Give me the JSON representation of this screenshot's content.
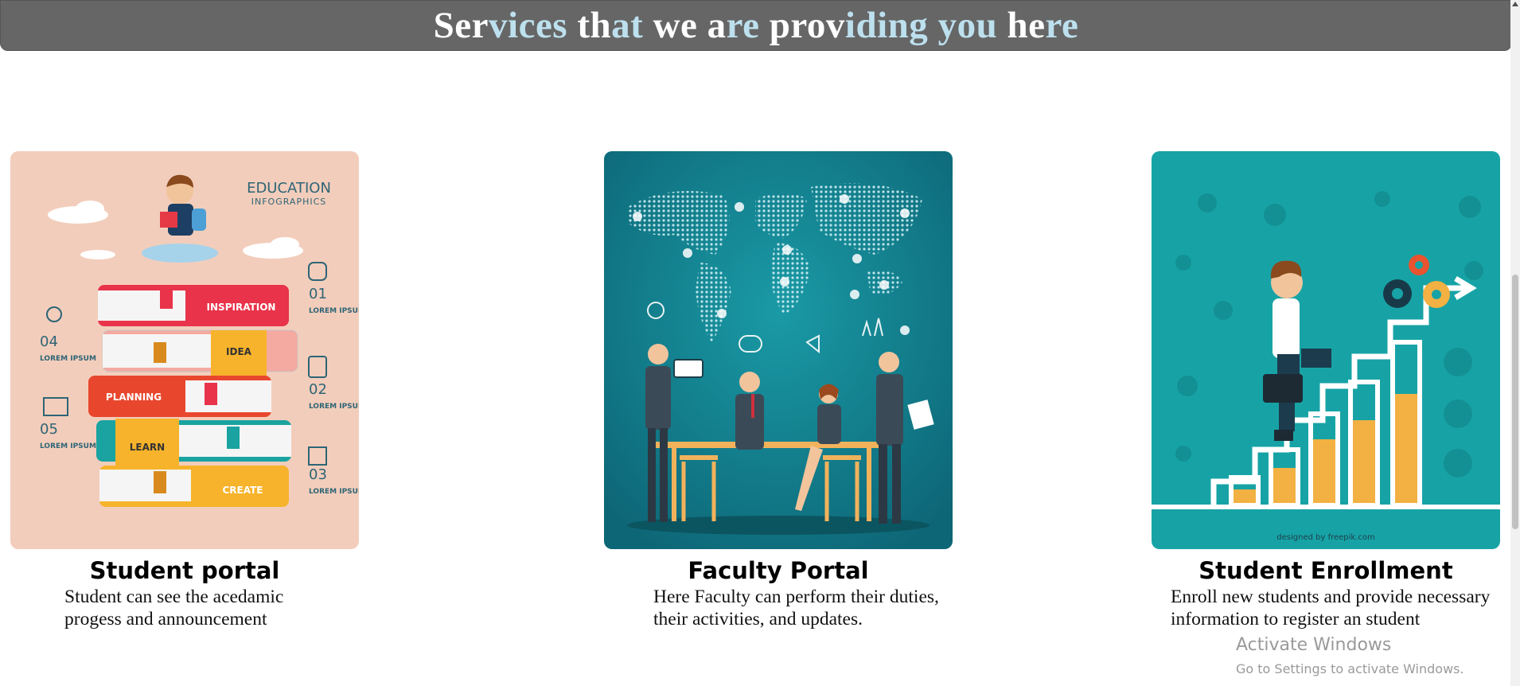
{
  "header": {
    "title_parts": [
      {
        "text": "Ser",
        "style": "w"
      },
      {
        "text": "vices",
        "style": "b"
      },
      {
        "text": " th",
        "style": "w"
      },
      {
        "text": "at",
        "style": "b"
      },
      {
        "text": " we",
        "style": "w"
      },
      {
        "text": " a",
        "style": "w"
      },
      {
        "text": "re",
        "style": "b"
      },
      {
        "text": " prov",
        "style": "w"
      },
      {
        "text": "iding",
        "style": "b"
      },
      {
        "text": " you",
        "style": "b"
      },
      {
        "text": " he",
        "style": "w"
      },
      {
        "text": "re",
        "style": "b"
      }
    ],
    "bar_color": "#666666",
    "highlight_color": "#bde0ee"
  },
  "cards": [
    {
      "title": "Student portal",
      "description": "Student can see the acedamic progess and announcement",
      "image": {
        "alt": "education-infographic",
        "heading": "EDUCATION",
        "subheading": "INFOGRAPHICS",
        "book_labels": [
          "INSPIRATION",
          "IDEA",
          "PLANNING",
          "LEARN",
          "CREATE"
        ],
        "steps": [
          {
            "num": "01",
            "text": "LOREM IPSUM"
          },
          {
            "num": "02",
            "text": "LOREM IPSUM"
          },
          {
            "num": "03",
            "text": "LOREM IPSUM"
          },
          {
            "num": "04",
            "text": "LOREM IPSUM"
          },
          {
            "num": "05",
            "text": "LOREM IPSUM"
          }
        ],
        "background": "#f3cdbb"
      }
    },
    {
      "title": "Faculty Portal",
      "description": "Here Faculty can perform their duties, their activities, and updates.",
      "image": {
        "alt": "business-meeting-world-map",
        "background": "#137f8c"
      }
    },
    {
      "title": "Student Enrollment",
      "description_lines": [
        "Enroll new students and provide necessary",
        "information to register an student"
      ],
      "image": {
        "alt": "growth-stairs-bar-chart",
        "credit": "designed by freepik.com",
        "background": "#17a3a6"
      }
    }
  ],
  "watermark": {
    "title": "Activate Windows",
    "subtitle": "Go to Settings to activate Windows."
  }
}
